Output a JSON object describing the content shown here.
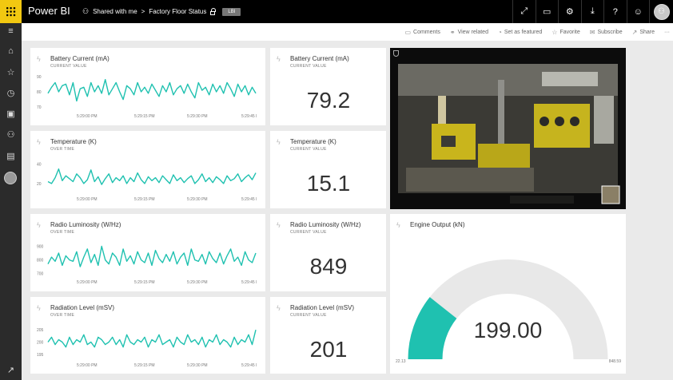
{
  "app": {
    "brand": "Power BI",
    "breadcrumb_shared": "Shared with me",
    "breadcrumb_separator": ">",
    "breadcrumb_dashboard": "Factory Floor Status",
    "badge": "LBI"
  },
  "top_icons": [
    "fullscreen-icon",
    "comment-icon",
    "gear-icon",
    "download-icon",
    "help-icon",
    "smiley-icon",
    "user-icon"
  ],
  "top_glyphs": [
    "⤢",
    "▭",
    "⚙",
    "⤓",
    "?",
    "☺",
    "⚇"
  ],
  "nav_icons": [
    "hamburger-icon",
    "home-icon",
    "star-icon",
    "clock-icon",
    "apps-icon",
    "shared-icon",
    "workspaces-icon"
  ],
  "nav_glyphs": [
    "≡",
    "⌂",
    "☆",
    "◷",
    "▣",
    "⚇",
    "▤"
  ],
  "nav_bottom_glyph": "↗",
  "actions": {
    "comments": "Comments",
    "view_related": "View related",
    "set_as_featured": "Set as featured",
    "favorite": "Favorite",
    "subscribe": "Subscribe",
    "share": "Share",
    "more": "···"
  },
  "tiles": {
    "battery_line": {
      "title": "Battery Current (mA)",
      "subtitle": "CURRENT VALUE",
      "yticks": [
        "90",
        "80",
        "70"
      ]
    },
    "battery_card": {
      "title": "Battery Current (mA)",
      "subtitle": "CURRENT VALUE",
      "value": "79.2"
    },
    "temp_line": {
      "title": "Temperature (K)",
      "subtitle": "OVER TIME",
      "yticks": [
        "40",
        "20"
      ]
    },
    "temp_card": {
      "title": "Temperature (K)",
      "subtitle": "CURRENT VALUE",
      "value": "15.1"
    },
    "radio_line": {
      "title": "Radio Luminosity (W/Hz)",
      "subtitle": "OVER TIME",
      "yticks": [
        "900",
        "800",
        "700"
      ]
    },
    "radio_card": {
      "title": "Radio Luminosity (W/Hz)",
      "subtitle": "CURRENT VALUE",
      "value": "849"
    },
    "rad_line": {
      "title": "Radiation Level (mSV)",
      "subtitle": "OVER TIME",
      "yticks": [
        "205",
        "200",
        "195"
      ]
    },
    "rad_card": {
      "title": "Radiation Level (mSV)",
      "subtitle": "CURRENT VALUE",
      "value": "201"
    },
    "gauge": {
      "title": "Engine Output (kN)",
      "value": "199.00",
      "min": "22.13",
      "max": "848.59"
    }
  },
  "xticks": [
    "5:29:00 PM",
    "5:29:15 PM",
    "5:29:30 PM",
    "5:29:45 I"
  ],
  "colors": {
    "accent": "#1fc1b0",
    "topbar": "#000000",
    "waffle": "#f2c811",
    "nav": "#2b2b2b",
    "gauge_track": "#e8e8e8"
  },
  "chart_data": [
    {
      "type": "line",
      "title": "Battery Current (mA)",
      "ylim": [
        68,
        92
      ],
      "series": [
        {
          "values": [
            79,
            83,
            86,
            80,
            84,
            85,
            78,
            86,
            74,
            82,
            83,
            77,
            86,
            80,
            84,
            79,
            88,
            78,
            82,
            86,
            80,
            75,
            84,
            82,
            78,
            86,
            80,
            83,
            79,
            85,
            81,
            77,
            84,
            80,
            86,
            78,
            82,
            84,
            79,
            85,
            80,
            76,
            86,
            81,
            83,
            78,
            85,
            80,
            84,
            79,
            86,
            82,
            77,
            85,
            80,
            84,
            78,
            83,
            79
          ]
        }
      ]
    },
    {
      "type": "line",
      "title": "Temperature (K)",
      "ylim": [
        10,
        48
      ],
      "series": [
        {
          "values": [
            22,
            20,
            26,
            35,
            23,
            28,
            25,
            22,
            30,
            26,
            20,
            24,
            34,
            22,
            27,
            19,
            25,
            30,
            21,
            26,
            23,
            28,
            20,
            26,
            22,
            31,
            24,
            20,
            27,
            23,
            26,
            21,
            28,
            24,
            20,
            29,
            23,
            26,
            21,
            25,
            28,
            20,
            24,
            30,
            22,
            26,
            21,
            27,
            24,
            20,
            28,
            23,
            25,
            30,
            22,
            26,
            29,
            24,
            31
          ]
        }
      ]
    },
    {
      "type": "line",
      "title": "Radio Luminosity (W/Hz)",
      "ylim": [
        680,
        950
      ],
      "series": [
        {
          "values": [
            770,
            820,
            790,
            850,
            760,
            830,
            800,
            790,
            860,
            750,
            820,
            880,
            780,
            840,
            760,
            900,
            800,
            770,
            850,
            820,
            760,
            880,
            790,
            830,
            770,
            860,
            800,
            780,
            850,
            760,
            870,
            810,
            780,
            840,
            790,
            860,
            770,
            820,
            850,
            760,
            880,
            800,
            790,
            840,
            770,
            860,
            810,
            780,
            850,
            770,
            830,
            880,
            790,
            820,
            760,
            860,
            800,
            780,
            850
          ]
        }
      ]
    },
    {
      "type": "line",
      "title": "Radiation Level (mSV)",
      "ylim": [
        193,
        208
      ],
      "series": [
        {
          "values": [
            200,
            202,
            199,
            201,
            200,
            198,
            202,
            199,
            201,
            200,
            203,
            199,
            200,
            198,
            202,
            201,
            199,
            200,
            202,
            199,
            201,
            198,
            203,
            200,
            199,
            201,
            200,
            202,
            198,
            201,
            200,
            203,
            199,
            200,
            201,
            198,
            202,
            200,
            199,
            203,
            200,
            201,
            199,
            202,
            198,
            201,
            200,
            203,
            199,
            201,
            200,
            198,
            202,
            199,
            201,
            200,
            203,
            199,
            205
          ]
        }
      ]
    },
    {
      "type": "gauge",
      "title": "Engine Output (kN)",
      "value": 199.0,
      "min": 22.13,
      "max": 848.59
    }
  ]
}
